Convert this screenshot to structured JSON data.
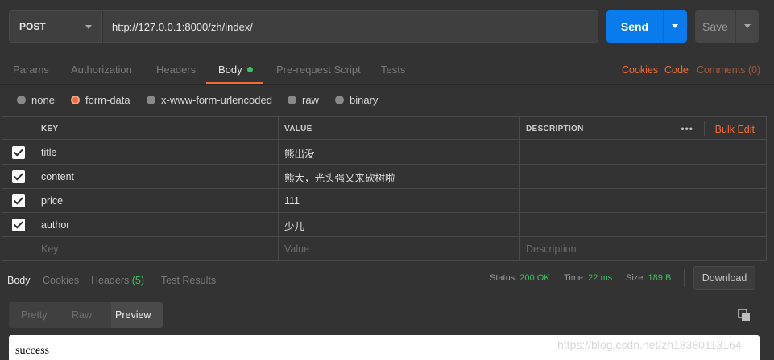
{
  "request": {
    "method": "POST",
    "url": "http://127.0.0.1:8000/zh/index/",
    "send_label": "Send",
    "save_label": "Save"
  },
  "request_tabs": [
    {
      "label": "Params"
    },
    {
      "label": "Authorization"
    },
    {
      "label": "Headers"
    },
    {
      "label": "Body"
    },
    {
      "label": "Pre-request Script"
    },
    {
      "label": "Tests"
    }
  ],
  "right_links": {
    "cookies": "Cookies",
    "code": "Code",
    "comments": "Comments (0)"
  },
  "body_types": [
    {
      "label": "none",
      "selected": false
    },
    {
      "label": "form-data",
      "selected": true
    },
    {
      "label": "x-www-form-urlencoded",
      "selected": false
    },
    {
      "label": "raw",
      "selected": false
    },
    {
      "label": "binary",
      "selected": false
    }
  ],
  "form_table": {
    "headers": {
      "key": "KEY",
      "value": "VALUE",
      "description": "DESCRIPTION"
    },
    "more_label": "•••",
    "bulk_edit": "Bulk Edit",
    "rows": [
      {
        "checked": true,
        "key": "title",
        "value": "熊出没",
        "description": ""
      },
      {
        "checked": true,
        "key": "content",
        "value": "熊大，光头强又来砍树啦",
        "description": ""
      },
      {
        "checked": true,
        "key": "price",
        "value": "111",
        "description": ""
      },
      {
        "checked": true,
        "key": "author",
        "value": "少儿",
        "description": ""
      }
    ],
    "placeholders": {
      "key": "Key",
      "value": "Value",
      "description": "Description"
    }
  },
  "response_tabs": [
    {
      "label": "Body"
    },
    {
      "label": "Cookies"
    },
    {
      "label": "Headers",
      "count": "(5)"
    },
    {
      "label": "Test Results"
    }
  ],
  "response_status": {
    "status_label": "Status:",
    "status_value": "200 OK",
    "time_label": "Time:",
    "time_value": "22 ms",
    "size_label": "Size:",
    "size_value": "189 B",
    "download_label": "Download"
  },
  "view_modes": [
    {
      "label": "Pretty"
    },
    {
      "label": "Raw"
    },
    {
      "label": "Preview"
    }
  ],
  "preview_text": "success",
  "watermark": "https://blog.csdn.net/zh18380113164",
  "colors": {
    "accent": "#f26b3a",
    "send_blue": "#097bed",
    "success_green": "#3fbf61",
    "background": "#333333"
  }
}
